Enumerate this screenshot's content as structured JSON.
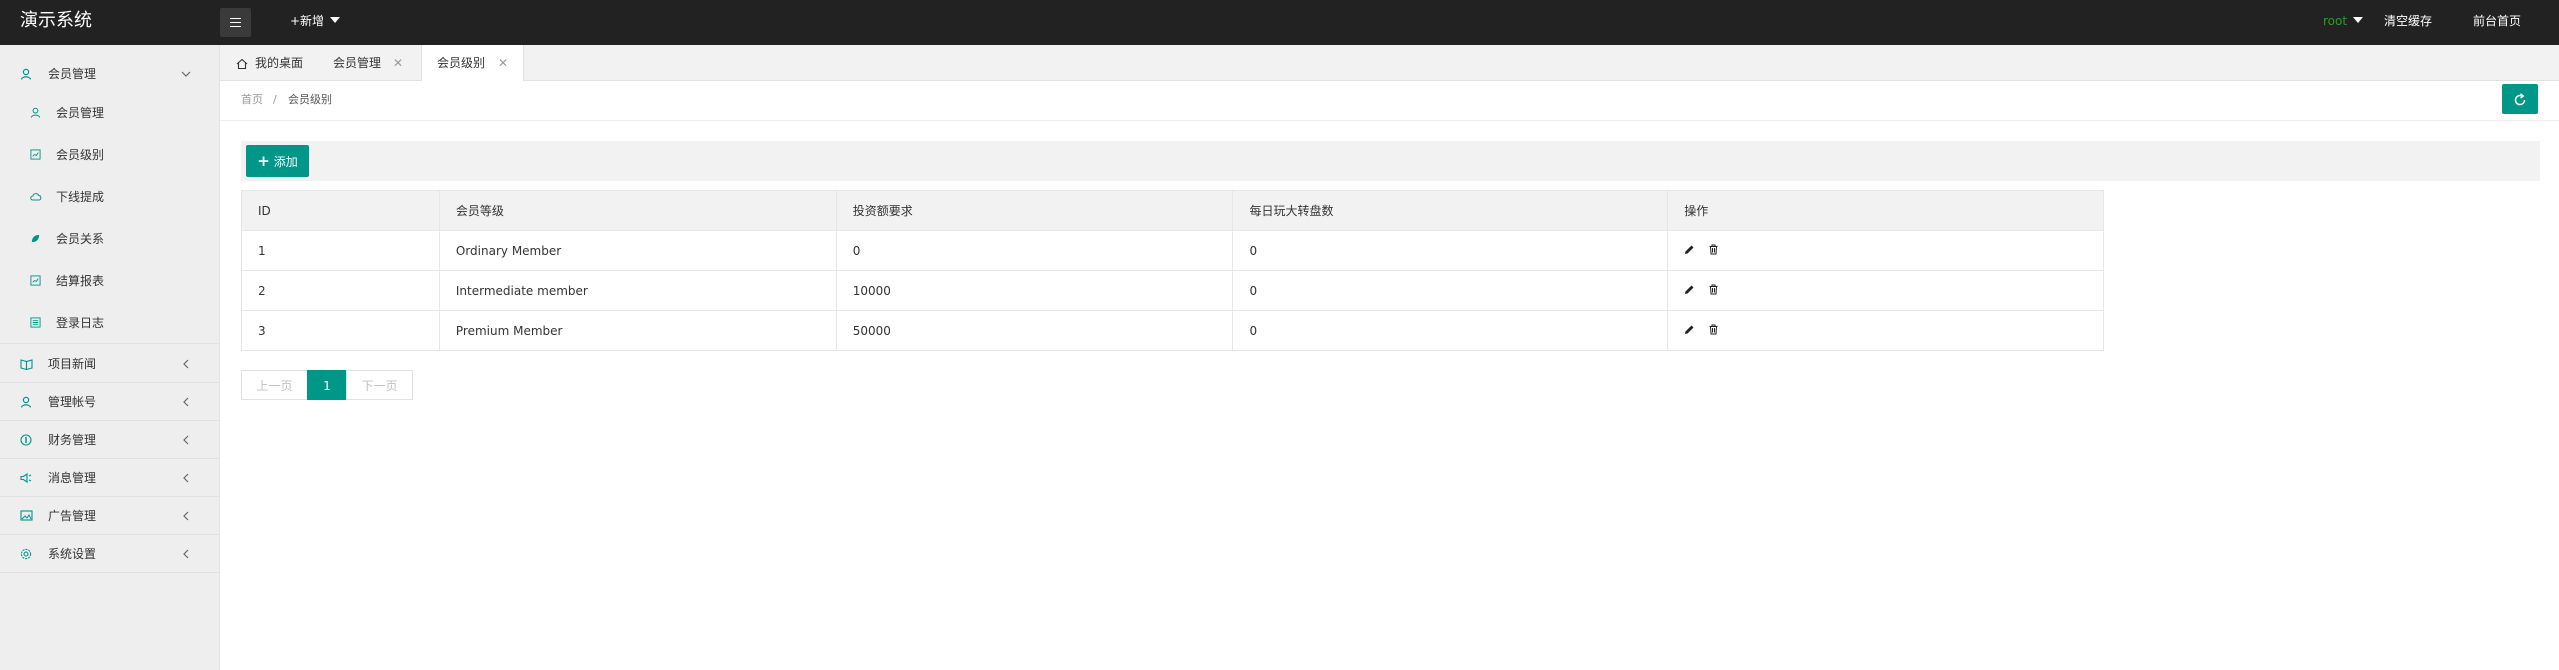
{
  "header": {
    "title": "演示系统",
    "new_label": "+新增",
    "user": "root",
    "clear_cache": "清空缓存",
    "front_home": "前台首页"
  },
  "sidebar": {
    "groups": [
      {
        "label": "会员管理",
        "icon": "user-icon",
        "expanded": true,
        "items": [
          {
            "label": "会员管理",
            "icon": "user-icon"
          },
          {
            "label": "会员级别",
            "icon": "chart-icon"
          },
          {
            "label": "下线提成",
            "icon": "cloud-icon"
          },
          {
            "label": "会员关系",
            "icon": "leaf-icon"
          },
          {
            "label": "结算报表",
            "icon": "chart-icon"
          },
          {
            "label": "登录日志",
            "icon": "list-icon"
          }
        ]
      },
      {
        "label": "项目新闻",
        "icon": "book-icon"
      },
      {
        "label": "管理帐号",
        "icon": "user-icon"
      },
      {
        "label": "财务管理",
        "icon": "shield-icon"
      },
      {
        "label": "消息管理",
        "icon": "speaker-icon"
      },
      {
        "label": "广告管理",
        "icon": "image-icon"
      },
      {
        "label": "系统设置",
        "icon": "gear-icon"
      }
    ]
  },
  "tabs": [
    {
      "label": "我的桌面",
      "icon": "home-icon"
    },
    {
      "label": "会员管理",
      "closable": true
    },
    {
      "label": "会员级别",
      "closable": true,
      "active": true
    }
  ],
  "breadcrumb": {
    "home": "首页",
    "separator": "/",
    "current": "会员级别"
  },
  "toolbar": {
    "add_label": "添加"
  },
  "table": {
    "headers": [
      "ID",
      "会员等级",
      "投资额要求",
      "每日玩大转盘数",
      "操作"
    ],
    "rows": [
      [
        "1",
        "Ordinary Member",
        "0",
        "0"
      ],
      [
        "2",
        "Intermediate member",
        "10000",
        "0"
      ],
      [
        "3",
        "Premium Member",
        "50000",
        "0"
      ]
    ]
  },
  "pagination": {
    "prev": "上一页",
    "current": "1",
    "next": "下一页"
  },
  "colors": {
    "accent": "#009688",
    "header_bg": "#222222",
    "sidebar_bg": "#eeeeee",
    "user": "#1ea41e"
  }
}
